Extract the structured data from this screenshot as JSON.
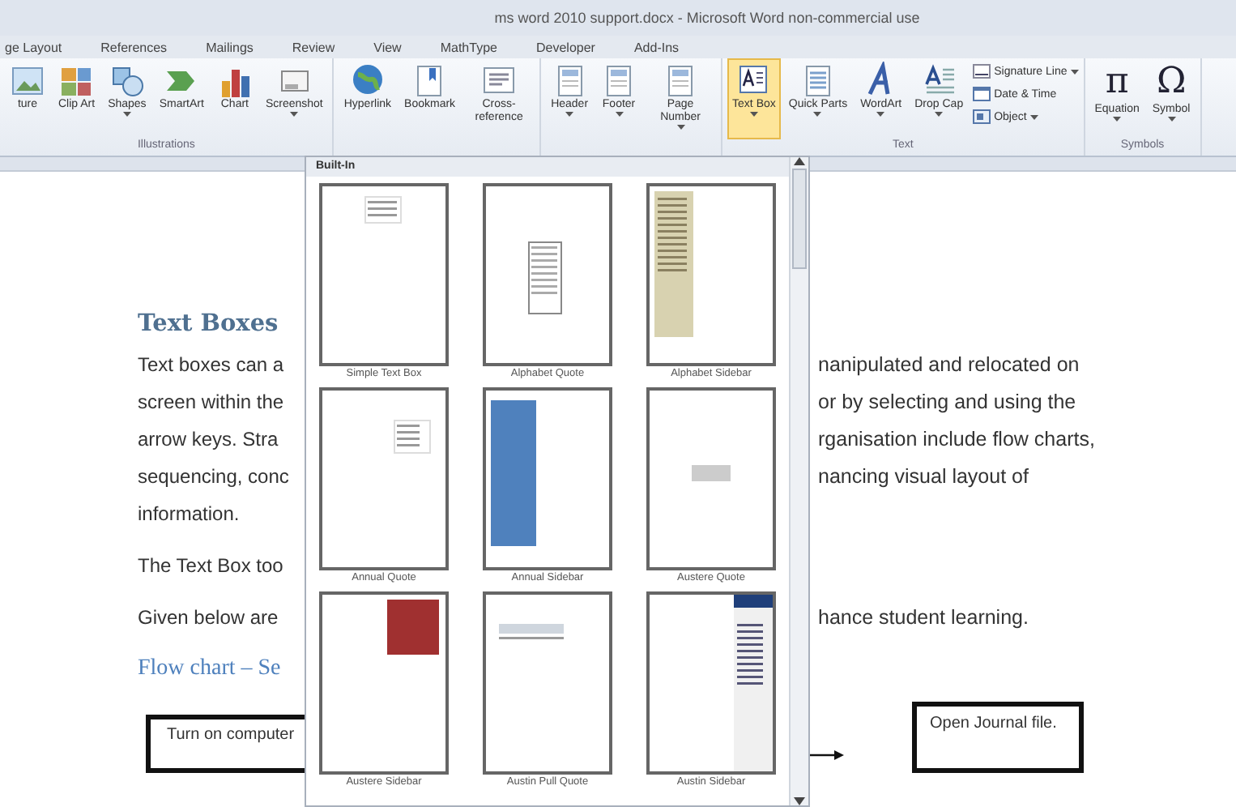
{
  "window": {
    "title": "ms word 2010 support.docx  -  Microsoft Word non-commercial use"
  },
  "tabs": [
    {
      "label": "ge Layout",
      "selected": false
    },
    {
      "label": "References",
      "selected": false
    },
    {
      "label": "Mailings",
      "selected": false
    },
    {
      "label": "Review",
      "selected": false
    },
    {
      "label": "View",
      "selected": false
    },
    {
      "label": "MathType",
      "selected": false
    },
    {
      "label": "Developer",
      "selected": false
    },
    {
      "label": "Add-Ins",
      "selected": false
    }
  ],
  "ribbon": {
    "groups": [
      {
        "label": "Illustrations",
        "buttons": [
          {
            "kind": "large",
            "label": "ture",
            "selected": false,
            "dropdown": false
          },
          {
            "kind": "large",
            "label": "Clip Art",
            "selected": false,
            "dropdown": false
          },
          {
            "kind": "large",
            "label": "Shapes",
            "selected": false,
            "dropdown": true
          },
          {
            "kind": "large",
            "label": "SmartArt",
            "selected": false,
            "dropdown": false
          },
          {
            "kind": "large",
            "label": "Chart",
            "selected": false,
            "dropdown": false
          },
          {
            "kind": "large",
            "label": "Screenshot",
            "selected": false,
            "dropdown": true
          }
        ]
      },
      {
        "buttons": [
          {
            "kind": "large",
            "label": "Hyperlink",
            "selected": false,
            "dropdown": false
          },
          {
            "kind": "large",
            "label": "Bookmark",
            "selected": false,
            "dropdown": false
          },
          {
            "kind": "large",
            "label": "Cross-reference",
            "selected": false,
            "dropdown": false
          }
        ]
      },
      {
        "buttons": [
          {
            "kind": "large",
            "label": "Header",
            "selected": false,
            "dropdown": true
          },
          {
            "kind": "large",
            "label": "Footer",
            "selected": false,
            "dropdown": true
          },
          {
            "kind": "large",
            "label": "Page Number",
            "selected": false,
            "dropdown": true
          }
        ]
      },
      {
        "label": "Text",
        "buttons": [
          {
            "kind": "large",
            "label": "Text Box",
            "selected": true,
            "dropdown": true
          },
          {
            "kind": "large",
            "label": "Quick Parts",
            "selected": false,
            "dropdown": true
          },
          {
            "kind": "large",
            "label": "WordArt",
            "selected": false,
            "dropdown": true
          },
          {
            "kind": "large",
            "label": "Drop Cap",
            "selected": false,
            "dropdown": true
          },
          {
            "kind": "small",
            "label": "Signature Line",
            "selected": false,
            "dropdown": true
          },
          {
            "kind": "small",
            "label": "Date & Time",
            "selected": false,
            "dropdown": false
          },
          {
            "kind": "small",
            "label": "Object",
            "selected": false,
            "dropdown": true
          }
        ]
      },
      {
        "label": "Symbols",
        "buttons": [
          {
            "kind": "glyph",
            "glyph": "π",
            "label": "Equation",
            "selected": false,
            "dropdown": true
          },
          {
            "kind": "glyph",
            "glyph": "Ω",
            "label": "Symbol",
            "selected": false,
            "dropdown": true
          }
        ]
      }
    ]
  },
  "document": {
    "paragraphs": [
      {
        "kind": "heading",
        "lines": [
          {
            "left": "Text Boxes"
          }
        ]
      },
      {
        "kind": "body",
        "lines": [
          {
            "left": "Text boxes can a",
            "right": "nanipulated and relocated on"
          },
          {
            "left": "screen within the",
            "right": "or by selecting and using the"
          },
          {
            "left": "arrow keys.  Stra",
            "right": "rganisation include flow charts,"
          },
          {
            "left": "sequencing, conc",
            "right": "nancing visual layout of"
          },
          {
            "left": "information."
          }
        ]
      },
      {
        "kind": "body",
        "lines": [
          {
            "left": "The Text Box too"
          }
        ]
      },
      {
        "kind": "body",
        "lines": [
          {
            "left": "Given below are",
            "right": "hance student learning."
          }
        ]
      },
      {
        "kind": "subheading",
        "lines": [
          {
            "left": "Flow chart – Se"
          }
        ]
      }
    ],
    "flowchart": {
      "first": "Turn on computer",
      "last": "Open Journal file."
    }
  },
  "gallery": {
    "header": "Built-In",
    "items": [
      {
        "label": "Simple Text Box"
      },
      {
        "label": "Alphabet Quote"
      },
      {
        "label": "Alphabet Sidebar"
      },
      {
        "label": "Annual Quote"
      },
      {
        "label": "Annual Sidebar"
      },
      {
        "label": "Austere Quote"
      },
      {
        "label": "Austere Sidebar"
      },
      {
        "label": "Austin Pull Quote"
      },
      {
        "label": "Austin Sidebar"
      }
    ]
  }
}
